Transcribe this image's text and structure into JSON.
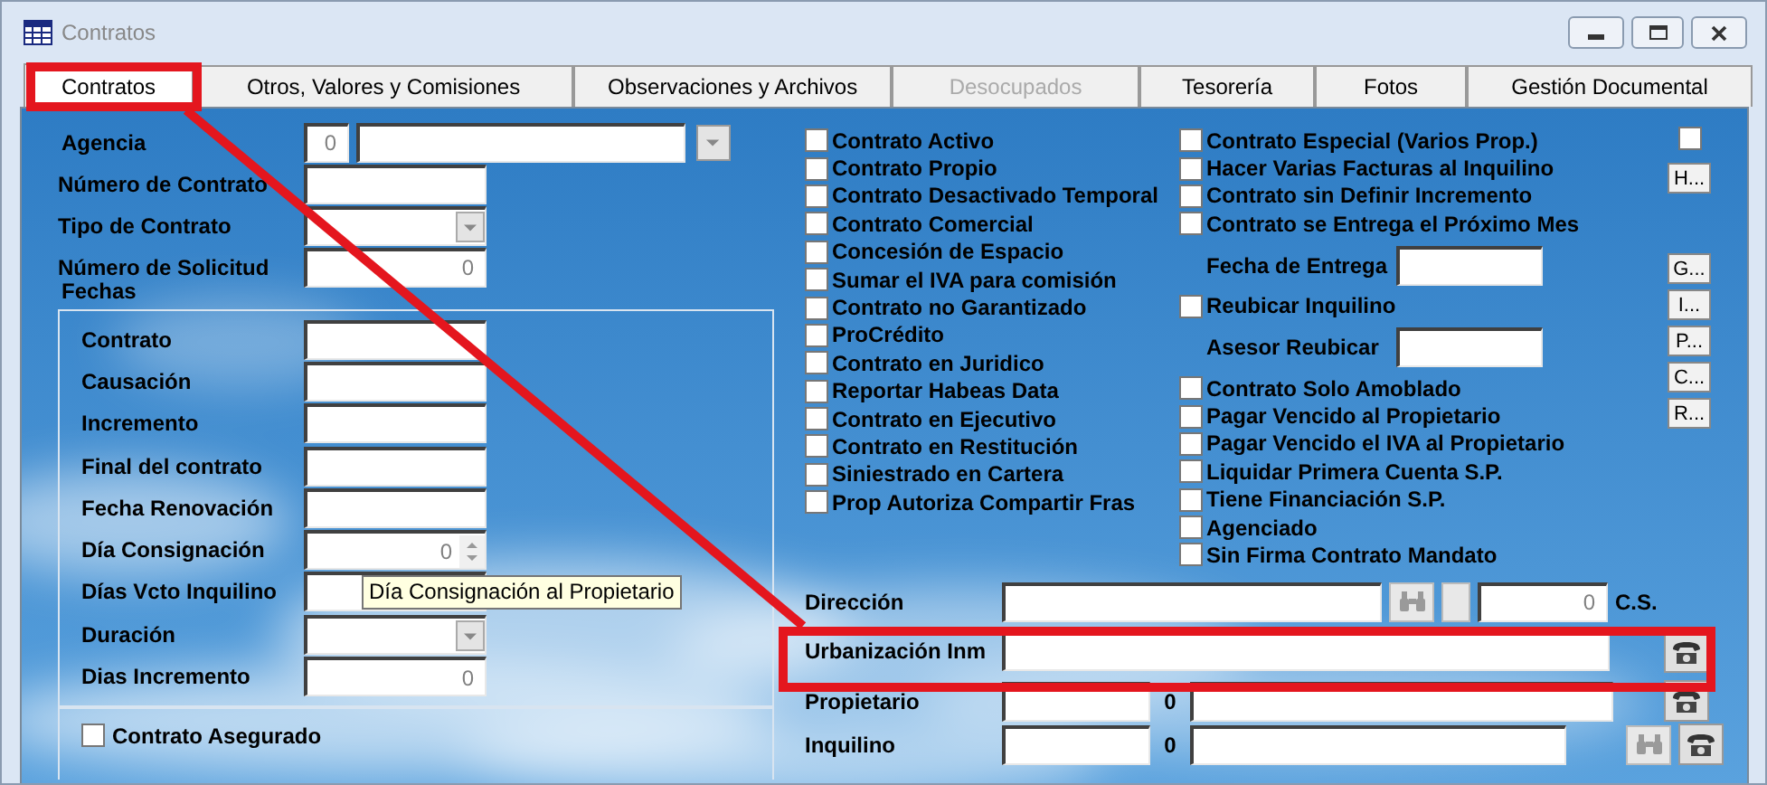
{
  "window": {
    "title": "Contratos"
  },
  "tabs": [
    {
      "label": "Contratos",
      "selected": true,
      "disabled": false
    },
    {
      "label": "Otros, Valores y Comisiones",
      "selected": false,
      "disabled": false
    },
    {
      "label": "Observaciones y Archivos",
      "selected": false,
      "disabled": false
    },
    {
      "label": "Desocupados",
      "selected": false,
      "disabled": true
    },
    {
      "label": "Tesorería",
      "selected": false,
      "disabled": false
    },
    {
      "label": "Fotos",
      "selected": false,
      "disabled": false
    },
    {
      "label": "Gestión Documental",
      "selected": false,
      "disabled": false
    }
  ],
  "general": [
    {
      "kind": "lookup",
      "label": "Agencia",
      "value": "0"
    },
    {
      "kind": "text",
      "label": "Número de Contrato"
    },
    {
      "kind": "combo",
      "label": "Tipo de Contrato"
    },
    {
      "kind": "text",
      "label": "Número de Solicitud",
      "value": "0"
    }
  ],
  "fechas": {
    "title": "Fechas",
    "fields": [
      {
        "kind": "text",
        "label": "Contrato"
      },
      {
        "kind": "text",
        "label": "Causación"
      },
      {
        "kind": "text",
        "label": "Incremento"
      },
      {
        "kind": "text",
        "label": "Final del contrato"
      },
      {
        "kind": "text",
        "label": "Fecha Renovación"
      },
      {
        "kind": "spin",
        "label": "Día Consignación",
        "value": "0"
      },
      {
        "kind": "spin",
        "label": "Días Vcto Inquilino"
      },
      {
        "kind": "combo",
        "label": "Duración"
      },
      {
        "kind": "text",
        "label": "Dias Incremento",
        "value": "0"
      }
    ]
  },
  "tooltip": "Día Consignación al Propietario",
  "asegurado": {
    "label": "Contrato Asegurado",
    "checked": false
  },
  "options_1": [
    {
      "label": "Contrato Activo",
      "checked": false
    },
    {
      "label": "Contrato Propio",
      "checked": false
    },
    {
      "label": "Contrato Desactivado Temporal",
      "checked": false
    },
    {
      "label": "Contrato Comercial",
      "checked": false
    },
    {
      "label": "Concesión de Espacio",
      "checked": false
    },
    {
      "label": "Sumar el IVA para comisión",
      "checked": false
    },
    {
      "label": "Contrato no Garantizado",
      "checked": false
    },
    {
      "label": "ProCrédito",
      "checked": false
    },
    {
      "label": "Contrato en Juridico",
      "checked": false
    },
    {
      "label": "Reportar Habeas Data",
      "checked": false
    },
    {
      "label": "Contrato en Ejecutivo",
      "checked": false
    },
    {
      "label": "Contrato en Restitución",
      "checked": false
    },
    {
      "label": "Siniestrado en Cartera",
      "checked": false
    },
    {
      "label": "Prop Autoriza Compartir Fras",
      "checked": false
    }
  ],
  "options_2": [
    {
      "kind": "check",
      "label": "Contrato Especial (Varios Prop.)",
      "checked": false
    },
    {
      "kind": "check",
      "label": "Hacer Varias Facturas al Inquilino",
      "checked": false
    },
    {
      "kind": "check",
      "label": "Contrato sin Definir Incremento",
      "checked": false
    },
    {
      "kind": "check",
      "label": "Contrato se Entrega el Próximo Mes",
      "checked": false
    },
    {
      "kind": "field",
      "label": "Fecha de Entrega"
    },
    {
      "kind": "check",
      "label": "Reubicar Inquilino",
      "checked": false
    },
    {
      "kind": "field",
      "label": "Asesor Reubicar"
    },
    {
      "kind": "check",
      "label": "Contrato Solo Amoblado",
      "checked": false
    },
    {
      "kind": "check",
      "label": "Pagar Vencido al Propietario",
      "checked": false
    },
    {
      "kind": "check",
      "label": "Pagar Vencido el IVA al Propietario",
      "checked": false
    },
    {
      "kind": "check",
      "label": "Liquidar Primera Cuenta S.P.",
      "checked": false
    },
    {
      "kind": "check",
      "label": "Tiene Financiación S.P.",
      "checked": false
    },
    {
      "kind": "check",
      "label": "Agenciado",
      "checked": false
    },
    {
      "kind": "check",
      "label": "Sin Firma Contrato Mandato",
      "checked": false
    }
  ],
  "extra_check": {
    "checked": false
  },
  "side_buttons": [
    "H...",
    "G...",
    "I...",
    "P...",
    "C...",
    "R..."
  ],
  "address_rows": [
    {
      "kind": "direccion",
      "label": "Dirección",
      "value": "0",
      "suffix": "C.S."
    },
    {
      "kind": "urbanizacion",
      "label": "Urbanización Inm"
    },
    {
      "kind": "party",
      "label": "Propietario",
      "code": "0",
      "lookup": false
    },
    {
      "kind": "party",
      "label": "Inquilino",
      "code": "0",
      "lookup": true
    }
  ]
}
